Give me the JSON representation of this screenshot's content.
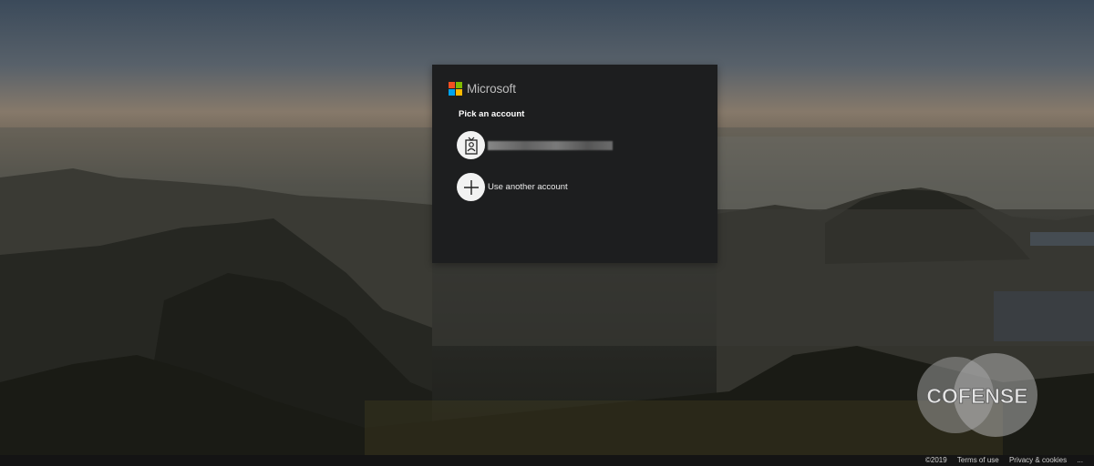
{
  "signin": {
    "brand": "Microsoft",
    "title": "Pick an account",
    "accounts": [
      {
        "label": ""
      },
      {
        "label": "Use another account"
      }
    ]
  },
  "watermark": {
    "text": "COFENSE"
  },
  "footer": {
    "copyright": "©2019",
    "terms": "Terms of use",
    "privacy": "Privacy & cookies",
    "more": "..."
  },
  "colors": {
    "logo_red": "#f25022",
    "logo_green": "#7fba00",
    "logo_blue": "#00a4ef",
    "logo_yellow": "#ffb900",
    "dialog_bg": "#1d1e1f"
  },
  "icons": [
    "user-badge-icon",
    "plus-icon"
  ]
}
